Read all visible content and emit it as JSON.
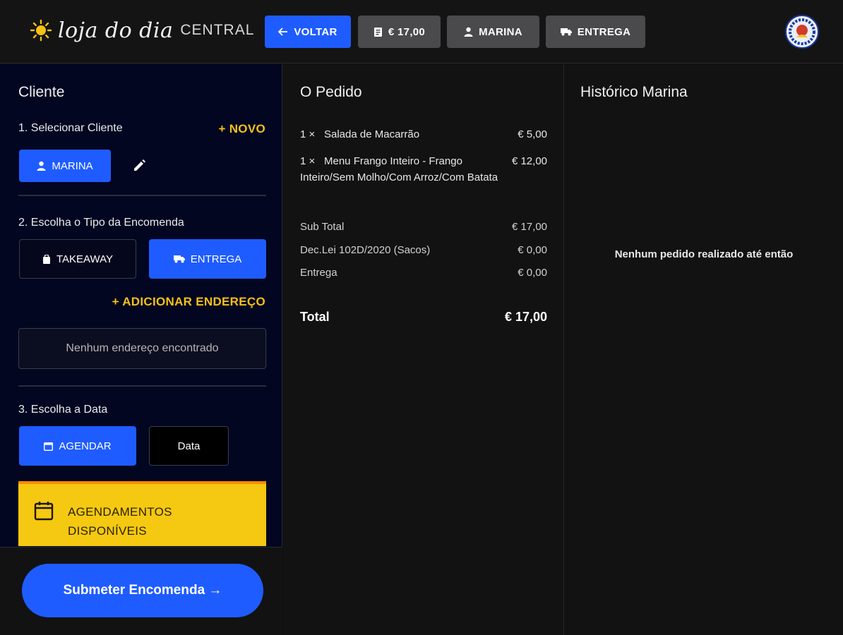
{
  "header": {
    "brand_script": "loja do dia",
    "brand_suffix": "CENTRAL",
    "back_label": "VOLTAR",
    "total_label": "€ 17,00",
    "client_label": "MARINA",
    "delivery_label": "ENTREGA",
    "icons": {
      "brand": "sun-icon",
      "back": "arrow-left-icon",
      "total": "receipt-icon",
      "client": "person-icon",
      "delivery": "truck-icon",
      "avatar": "avatar"
    }
  },
  "customer": {
    "title": "Cliente",
    "step1_label": "1. Selecionar Cliente",
    "new_link": "+ NOVO",
    "selected_client": "MARINA",
    "step2_label": "2. Escolha o Tipo da Encomenda",
    "takeaway_label": "TAKEAWAY",
    "delivery_label": "ENTREGA",
    "add_address_link": "+ ADICIONAR  ENDEREÇO",
    "address_empty": "Nenhum endereço encontrado",
    "step3_label": "3. Escolha a Data",
    "schedule_label": "AGENDAR",
    "date_label": "Data",
    "schedules_line1": "AGENDAMENTOS",
    "schedules_line2": "DISPONÍVEIS",
    "submit_label": "Submeter Encomenda →"
  },
  "order": {
    "title": "O Pedido",
    "items": [
      {
        "qty": "1  ×",
        "name": "Salada de Macarrão",
        "price": "€ 5,00"
      },
      {
        "qty": "1  ×",
        "name": "Menu Frango Inteiro - Frango Inteiro/Sem Molho/Com Arroz/Com Batata",
        "price": "€ 12,00"
      }
    ],
    "subtotal_label": "Sub Total",
    "subtotal_value": "€ 17,00",
    "bags_label": "Dec.Lei 102D/2020 (Sacos)",
    "bags_value": "€ 0,00",
    "delivery_label": "Entrega",
    "delivery_value": "€ 0,00",
    "total_label": "Total",
    "total_value": "€ 17,00"
  },
  "history": {
    "title": "Histórico Marina",
    "empty_message": "Nenhum pedido realizado até então"
  },
  "colors": {
    "accent_blue": "#1f5cff",
    "accent_yellow": "#f5c117",
    "schedule_card": "#f5c812",
    "left_panel": "#020621",
    "panel": "#121213"
  }
}
